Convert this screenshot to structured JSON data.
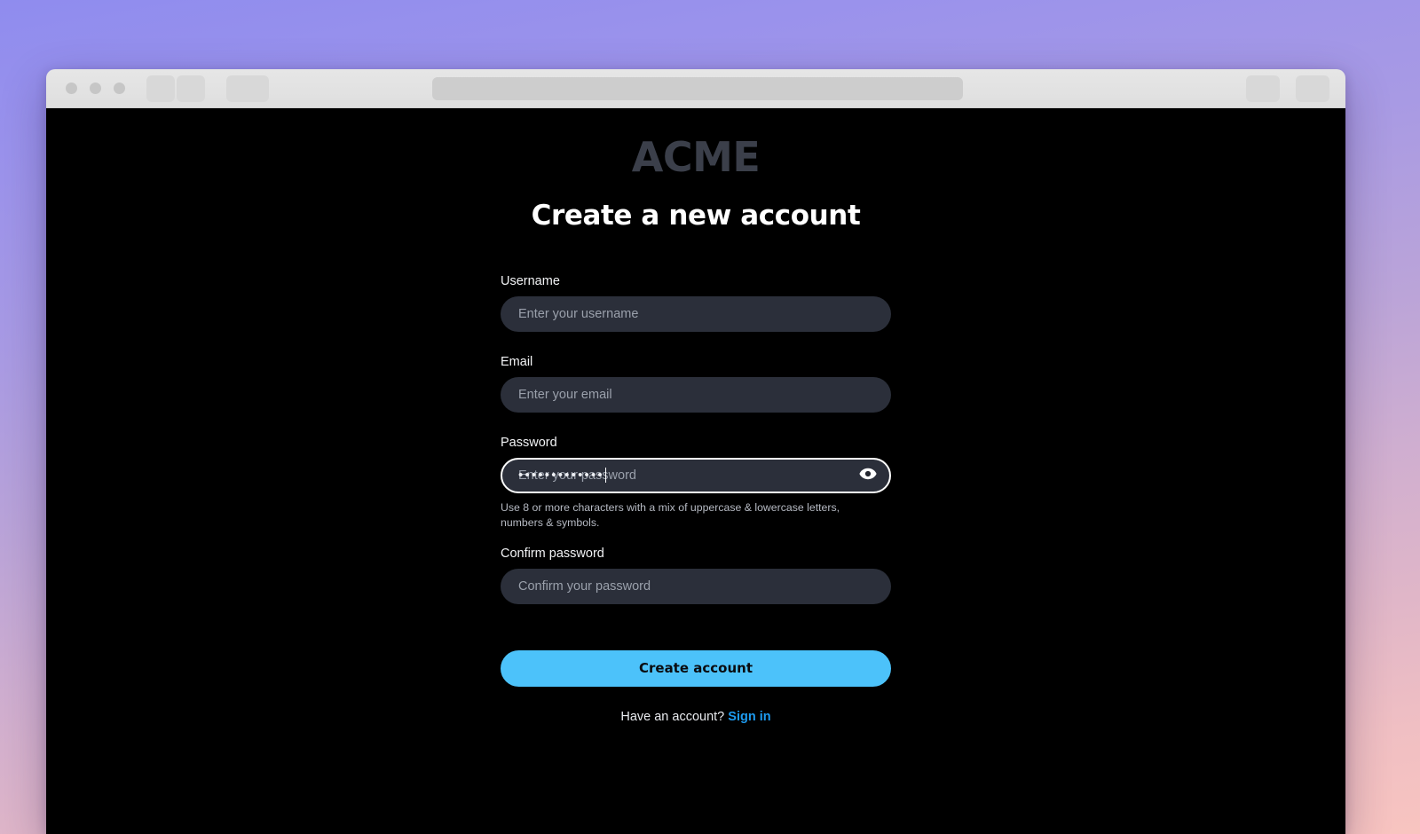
{
  "browser": {
    "traffic_lights": [
      "close",
      "minimize",
      "maximize"
    ],
    "url_bar_value": "",
    "url_bar_placeholder": ""
  },
  "brand": {
    "logo_text": "ACME",
    "logo_color": "#3b3f4a"
  },
  "page": {
    "background_color": "#000000",
    "accent_color": "#4cc2fa",
    "link_color": "#1d9bf0",
    "title": "Create a new account"
  },
  "form": {
    "fields": [
      {
        "id": "username",
        "label": "Username",
        "placeholder": "Enter your username",
        "value": "",
        "focused": false
      },
      {
        "id": "email",
        "label": "Email",
        "placeholder": "Enter your email",
        "value": "",
        "focused": false
      },
      {
        "id": "password",
        "label": "Password",
        "placeholder": "Enter your password",
        "value": "•••••••••••••",
        "focused": true,
        "helper": "Use 8 or more characters with a mix of uppercase & lowercase letters, numbers & symbols.",
        "reveal_icon": "eye-icon"
      },
      {
        "id": "confirm-password",
        "label": "Confirm password",
        "placeholder": "Confirm your password",
        "value": "",
        "focused": false
      }
    ],
    "submit_label": "Create account"
  },
  "footer": {
    "prompt": "Have an account?",
    "link_label": "Sign in"
  }
}
